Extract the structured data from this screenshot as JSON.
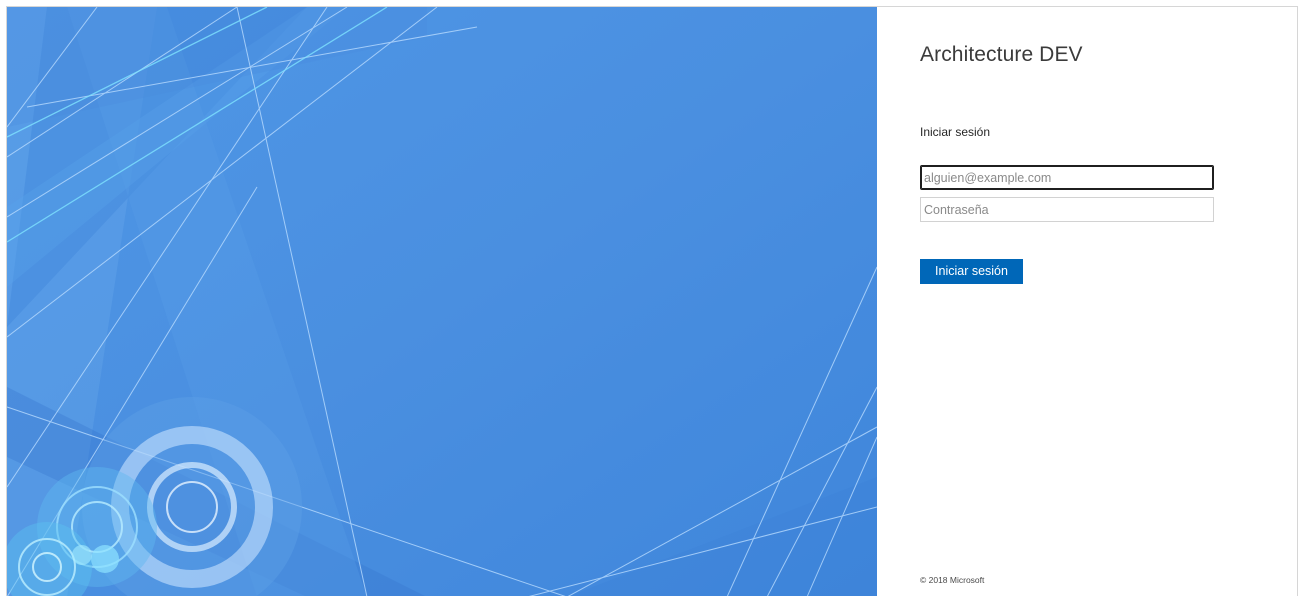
{
  "app": {
    "title": "Architecture DEV"
  },
  "signin": {
    "heading": "Iniciar sesión",
    "email_placeholder": "alguien@example.com",
    "email_value": "",
    "password_placeholder": "Contraseña",
    "password_value": "",
    "submit_label": "Iniciar sesión"
  },
  "footer": {
    "copyright": "© 2018 Microsoft"
  },
  "colors": {
    "illustration_background": "#4a90df",
    "primary_button": "#0067b8",
    "focus_border": "#1f1f1f"
  }
}
